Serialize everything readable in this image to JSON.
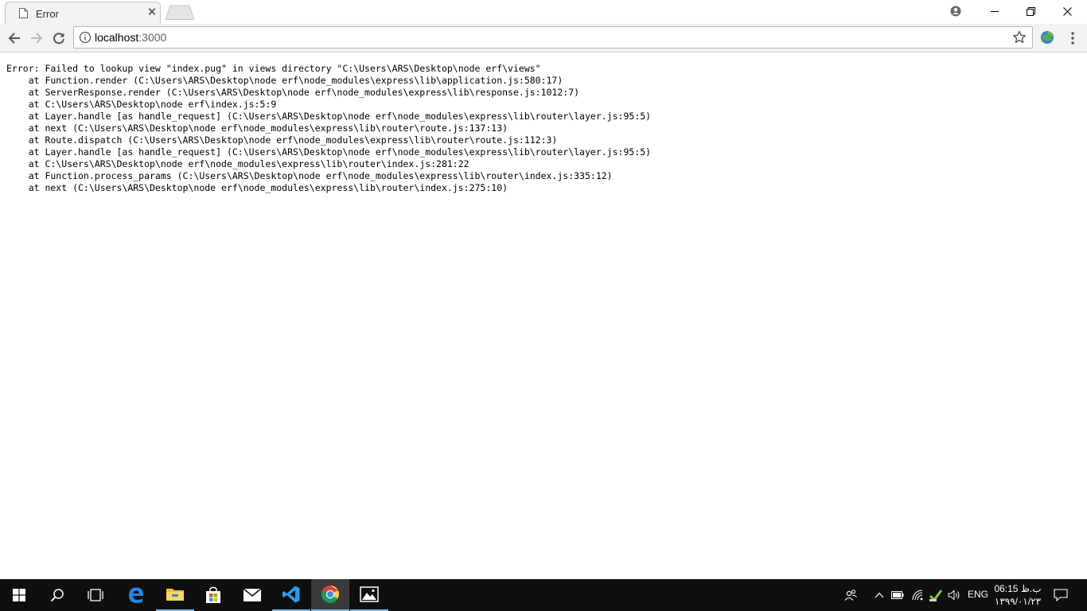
{
  "browser": {
    "tab": {
      "title": "Error",
      "close_glyph": "✕"
    },
    "address": {
      "host": "localhost",
      "port": ":3000"
    }
  },
  "page": {
    "error_text": "Error: Failed to lookup view \"index.pug\" in views directory \"C:\\Users\\ARS\\Desktop\\node erf\\views\"\n    at Function.render (C:\\Users\\ARS\\Desktop\\node erf\\node_modules\\express\\lib\\application.js:580:17)\n    at ServerResponse.render (C:\\Users\\ARS\\Desktop\\node erf\\node_modules\\express\\lib\\response.js:1012:7)\n    at C:\\Users\\ARS\\Desktop\\node erf\\index.js:5:9\n    at Layer.handle [as handle_request] (C:\\Users\\ARS\\Desktop\\node erf\\node_modules\\express\\lib\\router\\layer.js:95:5)\n    at next (C:\\Users\\ARS\\Desktop\\node erf\\node_modules\\express\\lib\\router\\route.js:137:13)\n    at Route.dispatch (C:\\Users\\ARS\\Desktop\\node erf\\node_modules\\express\\lib\\router\\route.js:112:3)\n    at Layer.handle [as handle_request] (C:\\Users\\ARS\\Desktop\\node erf\\node_modules\\express\\lib\\router\\layer.js:95:5)\n    at C:\\Users\\ARS\\Desktop\\node erf\\node_modules\\express\\lib\\router\\index.js:281:22\n    at Function.process_params (C:\\Users\\ARS\\Desktop\\node erf\\node_modules\\express\\lib\\router\\index.js:335:12)\n    at next (C:\\Users\\ARS\\Desktop\\node erf\\node_modules\\express\\lib\\router\\index.js:275:10)"
  },
  "taskbar": {
    "apps": [
      "windows-start-icon",
      "search-icon",
      "task-view-icon",
      "edge-icon",
      "file-explorer-icon",
      "store-icon",
      "mail-icon",
      "vscode-icon",
      "chrome-icon",
      "photos-icon"
    ],
    "tray": {
      "language": "ENG",
      "time": "06:15 ب.ظ",
      "date": "۱۳۹۹/۰۱/۲۳"
    }
  },
  "colors": {
    "taskbar_bg": "#0f0f0f",
    "running_indicator": "#76b9ed",
    "toolbar_bg": "#f2f2f2"
  }
}
